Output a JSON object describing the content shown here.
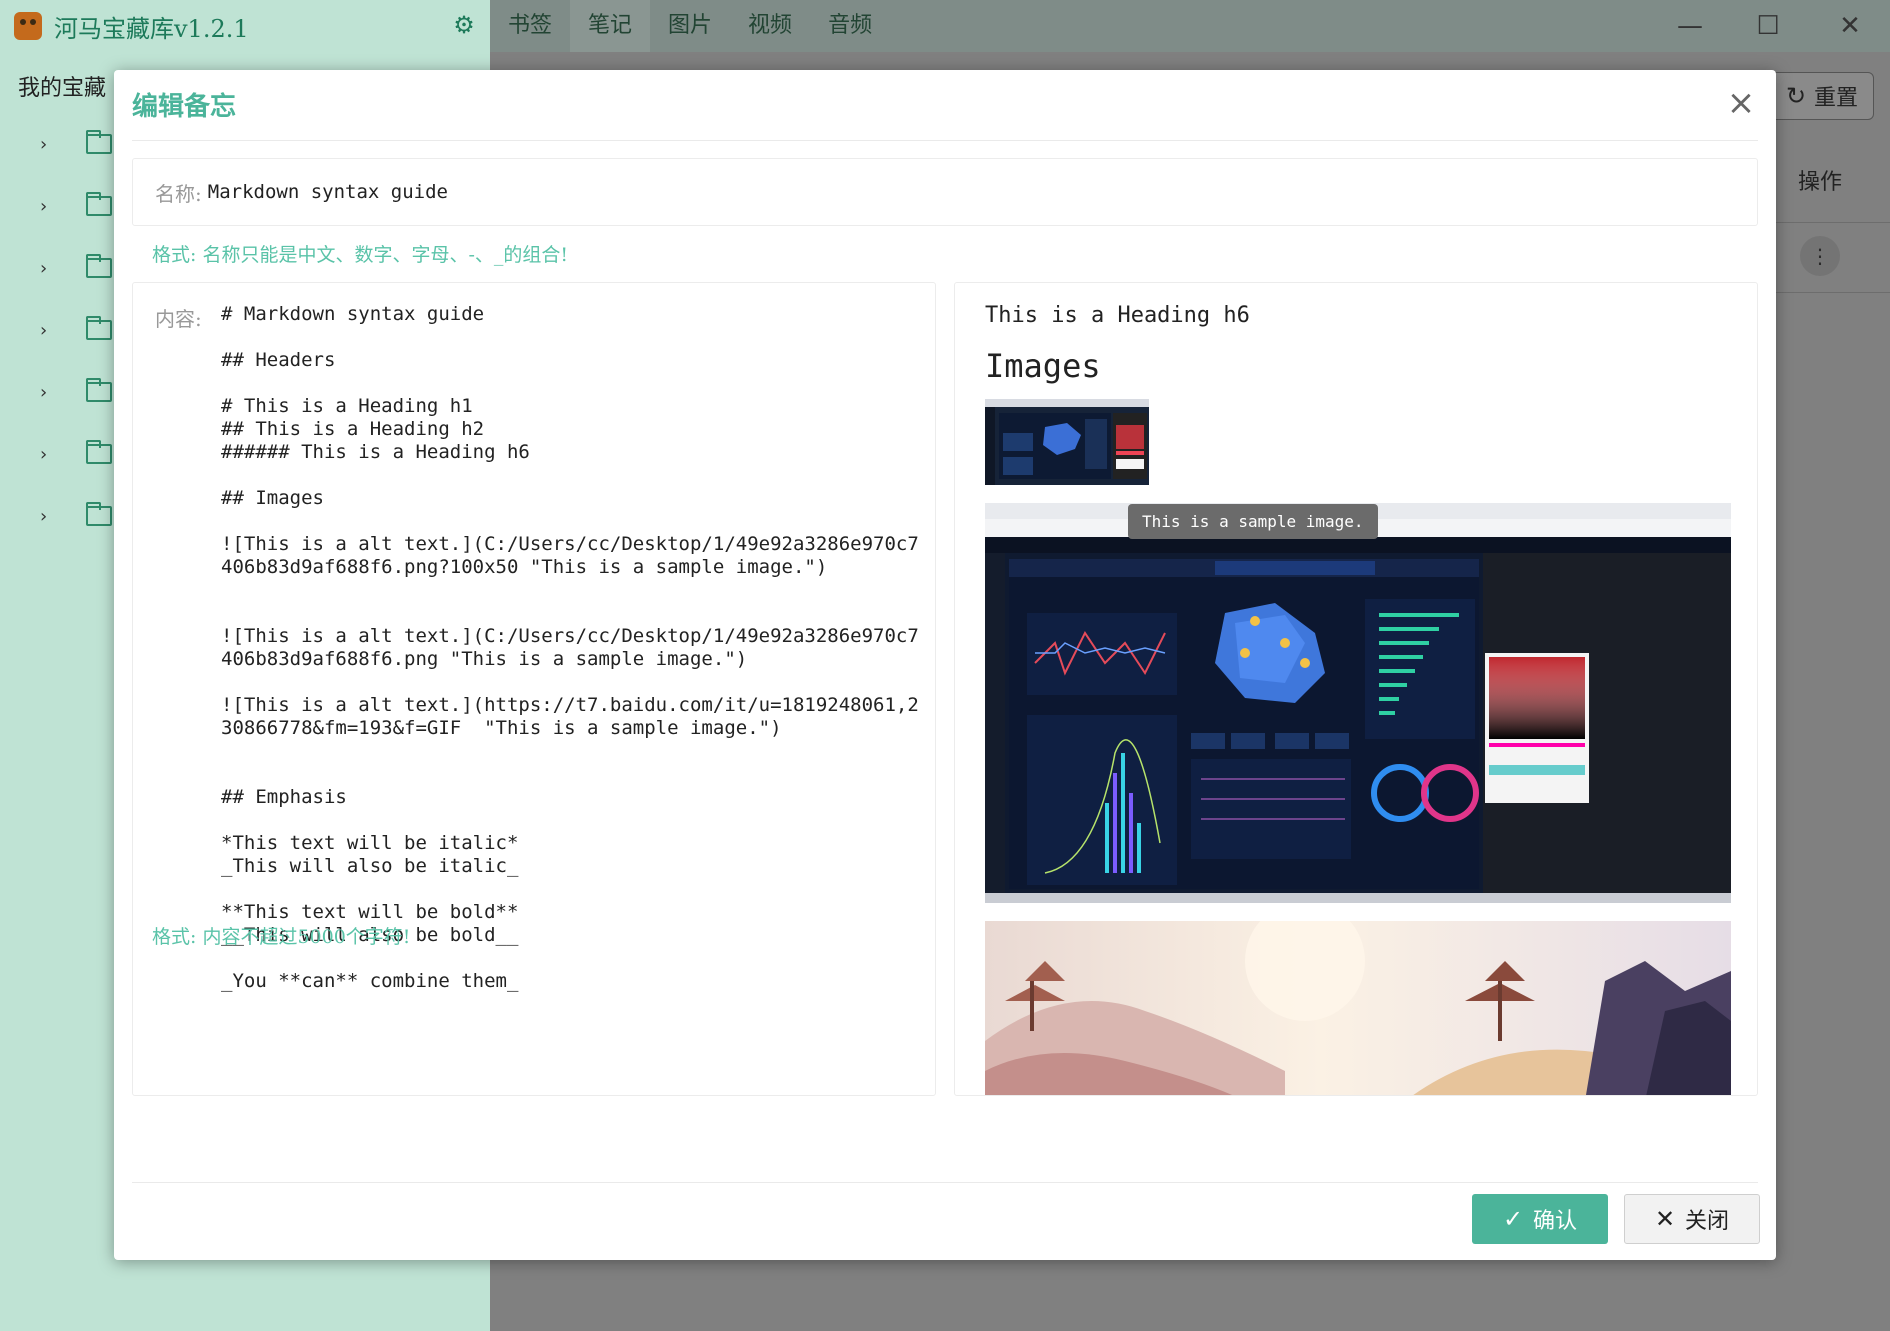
{
  "app": {
    "title": "河马宝藏库v1.2.1",
    "sidebar_heading": "我的宝藏",
    "tabs": [
      "书签",
      "笔记",
      "图片",
      "视频",
      "音频"
    ],
    "active_tab": "笔记",
    "reset_label": "重置",
    "ops_header": "操作",
    "accent_color": "#4bb49a"
  },
  "modal": {
    "title": "编辑备忘",
    "name_label": "名称:",
    "name_value": "Markdown syntax guide",
    "name_hint": "格式: 名称只能是中文、数字、字母、-、_的组合!",
    "content_label": "内容:",
    "content_text": "# Markdown syntax guide\n\n## Headers\n\n# This is a Heading h1\n## This is a Heading h2\n###### This is a Heading h6\n\n## Images\n\n![This is a alt text.](C:/Users/cc/Desktop/1/49e92a3286e970c7406b83d9af688f6.png?100x50 \"This is a sample image.\")\n\n\n![This is a alt text.](C:/Users/cc/Desktop/1/49e92a3286e970c7406b83d9af688f6.png \"This is a sample image.\")\n\n![This is a alt text.](https://t7.baidu.com/it/u=1819248061,230866778&fm=193&f=GIF  \"This is a sample image.\")\n\n\n## Emphasis\n\n*This text will be italic*\n_This will also be italic_\n\n**This text will be bold**\n__This will also be bold__\n\n_You **can** combine them_",
    "content_hint": "格式: 内容不超过5000个字符!",
    "preview": {
      "heading_h6": "This is a Heading h6",
      "heading_images": "Images",
      "tooltip": "This is a sample image."
    },
    "ok_label": "确认",
    "close_label": "关闭"
  }
}
